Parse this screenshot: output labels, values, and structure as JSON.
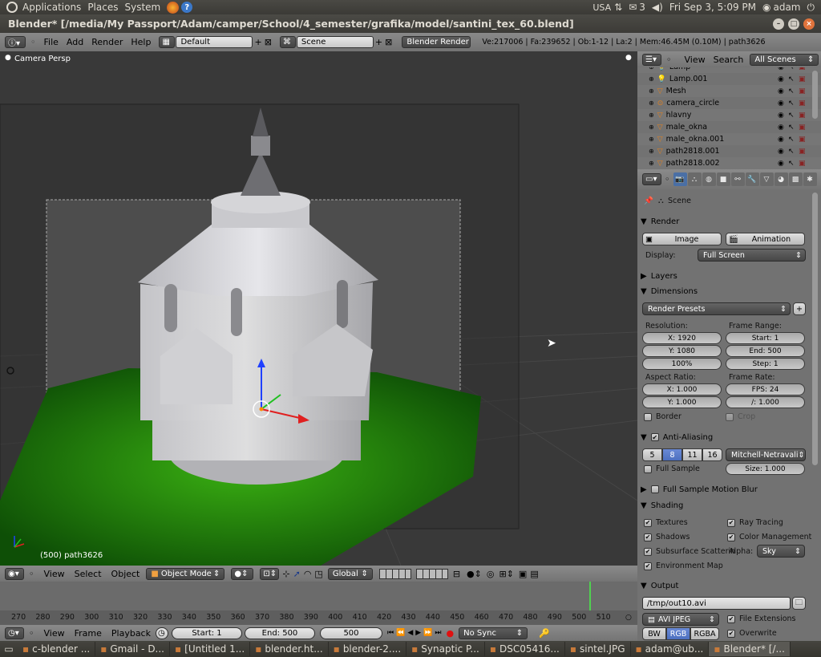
{
  "topbar": {
    "applications": "Applications",
    "places": "Places",
    "system": "System",
    "keyboard": "USA",
    "mail_count": "3",
    "clock": "Fri Sep  3,  5:09 PM",
    "user": "adam"
  },
  "window": {
    "title": "Blender* [/media/My Passport/Adam/camper/School/4_semester/grafika/model/santini_tex_60.blend]"
  },
  "menubar": {
    "file": "File",
    "add": "Add",
    "render": "Render",
    "help": "Help",
    "layout": "Default",
    "scene": "Scene",
    "engine": "Blender Render",
    "stats": "Ve:217006 | Fa:239652 | Ob:1-12 | La:2 | Mem:46.45M (0.10M) | path3626"
  },
  "viewport": {
    "label": "Camera Persp",
    "object_label": "(500) path3626"
  },
  "vphead": {
    "view": "View",
    "select": "Select",
    "object": "Object",
    "mode": "Object Mode",
    "orientation": "Global"
  },
  "timeline": {
    "ticks": [
      "270",
      "280",
      "290",
      "300",
      "310",
      "320",
      "330",
      "340",
      "350",
      "360",
      "370",
      "380",
      "390",
      "400",
      "410",
      "420",
      "430",
      "440",
      "450",
      "460",
      "470",
      "480",
      "490",
      "500",
      "510"
    ],
    "view": "View",
    "frame": "Frame",
    "playback": "Playback",
    "start": "Start: 1",
    "end": "End: 500",
    "current": "500",
    "sync": "No Sync"
  },
  "taskbar": [
    "c-blender ...",
    "Gmail - D...",
    "[Untitled 1...",
    "blender.ht...",
    "blender-2....",
    "Synaptic P...",
    "DSC05416...",
    "sintel.JPG",
    "adam@ub...",
    "Blender* [/..."
  ],
  "outliner": {
    "view": "View",
    "search": "Search",
    "scenes": "All Scenes",
    "items": [
      "Lamp",
      "Lamp.001",
      "Mesh",
      "camera_circle",
      "hlavny",
      "male_okna",
      "male_okna.001",
      "path2818.001",
      "path2818.002"
    ]
  },
  "props": {
    "scene": "Scene",
    "render": {
      "title": "Render",
      "image": "Image",
      "animation": "Animation",
      "display_label": "Display:",
      "display": "Full Screen"
    },
    "layers": "Layers",
    "dimensions": {
      "title": "Dimensions",
      "presets": "Render Presets",
      "resolution": "Resolution:",
      "x": "X: 1920",
      "y": "Y: 1080",
      "pct": "100%",
      "frame_range": "Frame Range:",
      "start": "Start: 1",
      "end": "End: 500",
      "step": "Step: 1",
      "aspect": "Aspect Ratio:",
      "ax": "X: 1.000",
      "ay": "Y: 1.000",
      "frame_rate": "Frame Rate:",
      "fps": "FPS: 24",
      "fpsbase": "/: 1.000",
      "border": "Border",
      "crop": "Crop"
    },
    "aa": {
      "title": "Anti-Aliasing",
      "s5": "5",
      "s8": "8",
      "s11": "11",
      "s16": "16",
      "filter": "Mitchell-Netravali",
      "full_sample": "Full Sample",
      "size": "Size: 1.000"
    },
    "motion_blur": "Full Sample Motion Blur",
    "shading": {
      "title": "Shading",
      "textures": "Textures",
      "ray": "Ray Tracing",
      "shadows": "Shadows",
      "color_mgmt": "Color Management",
      "sss": "Subsurface Scatterin",
      "alpha": "Alpha:",
      "alpha_val": "Sky",
      "env": "Environment Map"
    },
    "output": {
      "title": "Output",
      "path": "/tmp/out10.avi",
      "format": "AVI JPEG",
      "file_ext": "File Extensions",
      "bw": "BW",
      "rgb": "RGB",
      "rgba": "RGBA",
      "overwrite": "Overwrite"
    }
  }
}
